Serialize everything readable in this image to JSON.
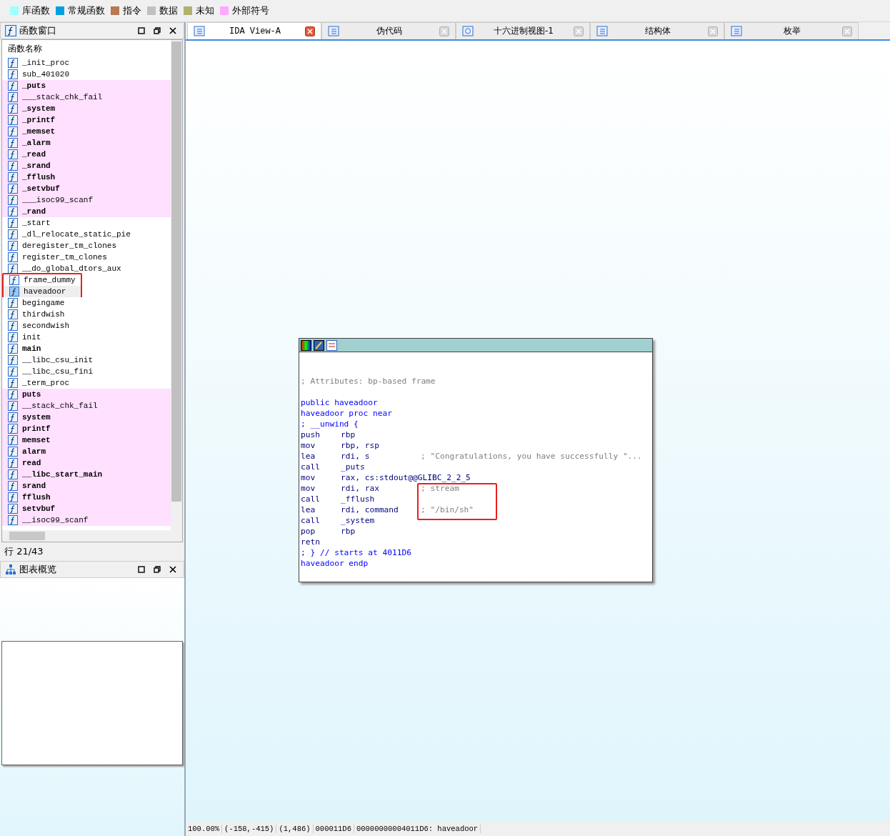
{
  "legend": [
    {
      "label": "库函数",
      "color": "#a0ffff"
    },
    {
      "label": "常规函数",
      "color": "#00a0e0"
    },
    {
      "label": "指令",
      "color": "#b87850"
    },
    {
      "label": "数据",
      "color": "#c0c0c0"
    },
    {
      "label": "未知",
      "color": "#b0b070"
    },
    {
      "label": "外部符号",
      "color": "#ffa8ff"
    }
  ],
  "functions_window": {
    "title": "函数窗口",
    "column": "函数名称",
    "status": "行 21/43",
    "rows": [
      {
        "name": "_init_proc",
        "bold": false,
        "extern": false,
        "selected": false,
        "boxed": false
      },
      {
        "name": "sub_401020",
        "bold": false,
        "extern": false,
        "selected": false,
        "boxed": false
      },
      {
        "name": "_puts",
        "bold": true,
        "extern": true,
        "selected": false,
        "boxed": false
      },
      {
        "name": "___stack_chk_fail",
        "bold": false,
        "extern": true,
        "selected": false,
        "boxed": false
      },
      {
        "name": "_system",
        "bold": true,
        "extern": true,
        "selected": false,
        "boxed": false
      },
      {
        "name": "_printf",
        "bold": true,
        "extern": true,
        "selected": false,
        "boxed": false
      },
      {
        "name": "_memset",
        "bold": true,
        "extern": true,
        "selected": false,
        "boxed": false
      },
      {
        "name": "_alarm",
        "bold": true,
        "extern": true,
        "selected": false,
        "boxed": false
      },
      {
        "name": "_read",
        "bold": true,
        "extern": true,
        "selected": false,
        "boxed": false
      },
      {
        "name": "_srand",
        "bold": true,
        "extern": true,
        "selected": false,
        "boxed": false
      },
      {
        "name": "_fflush",
        "bold": true,
        "extern": true,
        "selected": false,
        "boxed": false
      },
      {
        "name": "_setvbuf",
        "bold": true,
        "extern": true,
        "selected": false,
        "boxed": false
      },
      {
        "name": "___isoc99_scanf",
        "bold": false,
        "extern": true,
        "selected": false,
        "boxed": false
      },
      {
        "name": "_rand",
        "bold": true,
        "extern": true,
        "selected": false,
        "boxed": false
      },
      {
        "name": "_start",
        "bold": false,
        "extern": false,
        "selected": false,
        "boxed": false
      },
      {
        "name": "_dl_relocate_static_pie",
        "bold": false,
        "extern": false,
        "selected": false,
        "boxed": false
      },
      {
        "name": "deregister_tm_clones",
        "bold": false,
        "extern": false,
        "selected": false,
        "boxed": false
      },
      {
        "name": "register_tm_clones",
        "bold": false,
        "extern": false,
        "selected": false,
        "boxed": false
      },
      {
        "name": "__do_global_dtors_aux",
        "bold": false,
        "extern": false,
        "selected": false,
        "boxed": false
      },
      {
        "name": "frame_dummy",
        "bold": false,
        "extern": false,
        "selected": false,
        "boxed": true
      },
      {
        "name": "haveadoor",
        "bold": false,
        "extern": false,
        "selected": true,
        "boxed": true
      },
      {
        "name": "begingame",
        "bold": false,
        "extern": false,
        "selected": false,
        "boxed": false
      },
      {
        "name": "thirdwish",
        "bold": false,
        "extern": false,
        "selected": false,
        "boxed": false
      },
      {
        "name": "secondwish",
        "bold": false,
        "extern": false,
        "selected": false,
        "boxed": false
      },
      {
        "name": "init",
        "bold": false,
        "extern": false,
        "selected": false,
        "boxed": false
      },
      {
        "name": "main",
        "bold": true,
        "extern": false,
        "selected": false,
        "boxed": false
      },
      {
        "name": "__libc_csu_init",
        "bold": false,
        "extern": false,
        "selected": false,
        "boxed": false
      },
      {
        "name": "__libc_csu_fini",
        "bold": false,
        "extern": false,
        "selected": false,
        "boxed": false
      },
      {
        "name": "_term_proc",
        "bold": false,
        "extern": false,
        "selected": false,
        "boxed": false
      },
      {
        "name": "puts",
        "bold": true,
        "extern": true,
        "selected": false,
        "boxed": false
      },
      {
        "name": "__stack_chk_fail",
        "bold": false,
        "extern": true,
        "selected": false,
        "boxed": false
      },
      {
        "name": "system",
        "bold": true,
        "extern": true,
        "selected": false,
        "boxed": false
      },
      {
        "name": "printf",
        "bold": true,
        "extern": true,
        "selected": false,
        "boxed": false
      },
      {
        "name": "memset",
        "bold": true,
        "extern": true,
        "selected": false,
        "boxed": false
      },
      {
        "name": "alarm",
        "bold": true,
        "extern": true,
        "selected": false,
        "boxed": false
      },
      {
        "name": "read",
        "bold": true,
        "extern": true,
        "selected": false,
        "boxed": false
      },
      {
        "name": "__libc_start_main",
        "bold": true,
        "extern": true,
        "selected": false,
        "boxed": false
      },
      {
        "name": "srand",
        "bold": true,
        "extern": true,
        "selected": false,
        "boxed": false
      },
      {
        "name": "fflush",
        "bold": true,
        "extern": true,
        "selected": false,
        "boxed": false
      },
      {
        "name": "setvbuf",
        "bold": true,
        "extern": true,
        "selected": false,
        "boxed": false
      },
      {
        "name": "__isoc99_scanf",
        "bold": false,
        "extern": true,
        "selected": false,
        "boxed": false
      }
    ]
  },
  "overview": {
    "title": "图表概览"
  },
  "tabs": [
    {
      "label": "IDA View-A",
      "selected": true
    },
    {
      "label": "伪代码",
      "selected": false
    },
    {
      "label": "十六进制视图-1",
      "selected": false
    },
    {
      "label": "结构体",
      "selected": false
    },
    {
      "label": "枚举",
      "selected": false
    }
  ],
  "code": [
    {
      "kind": "comment",
      "text": "; Attributes: bp-based frame"
    },
    {
      "kind": "gap"
    },
    {
      "kind": "label",
      "text": "public haveadoor"
    },
    {
      "kind": "label",
      "text": "haveadoor proc near"
    },
    {
      "kind": "label",
      "text": "; __unwind {"
    },
    {
      "kind": "instr",
      "mnemonic": "push",
      "operands": "rbp"
    },
    {
      "kind": "instr",
      "mnemonic": "mov",
      "operands": "rbp, rsp"
    },
    {
      "kind": "instr",
      "mnemonic": "lea",
      "operands": "rdi, s",
      "comment": "; \"Congratulations, you have successfully \"..."
    },
    {
      "kind": "instr",
      "mnemonic": "call",
      "operands": "_puts"
    },
    {
      "kind": "instr",
      "mnemonic": "mov",
      "operands": "rax, cs:stdout@@GLIBC_2_2_5"
    },
    {
      "kind": "instr",
      "mnemonic": "mov",
      "operands": "rdi, rax",
      "comment": "; stream"
    },
    {
      "kind": "instr",
      "mnemonic": "call",
      "operands": "_fflush"
    },
    {
      "kind": "instr",
      "mnemonic": "lea",
      "operands": "rdi, command",
      "comment": "; \"/bin/sh\"",
      "boxed": true
    },
    {
      "kind": "instr",
      "mnemonic": "call",
      "operands": "_system"
    },
    {
      "kind": "instr",
      "mnemonic": "pop",
      "operands": "rbp"
    },
    {
      "kind": "instr",
      "mnemonic": "retn"
    },
    {
      "kind": "label",
      "text": "; } // starts at 4011D6"
    },
    {
      "kind": "label",
      "text": "haveadoor endp"
    }
  ],
  "status_bar": [
    "100.00%",
    "(-158,-415)",
    "(1,486)",
    "000011D6",
    "00000000004011D6: haveadoor"
  ]
}
